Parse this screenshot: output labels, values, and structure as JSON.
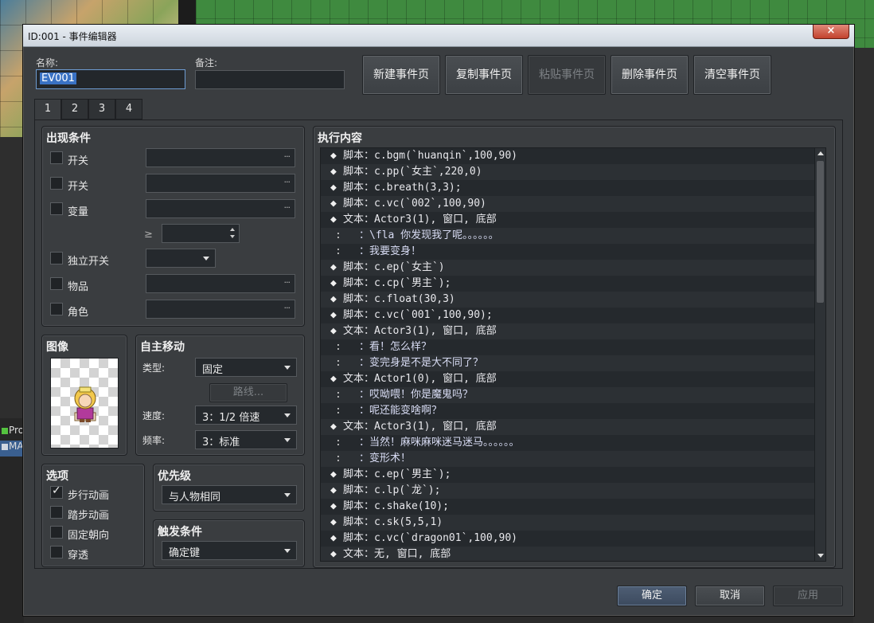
{
  "background": {
    "project_item": "Pro",
    "map_item": "MA"
  },
  "dialog": {
    "title": "ID:001 - 事件编辑器",
    "close_glyph": "×"
  },
  "header": {
    "name_label": "名称:",
    "name_value": "EV001",
    "note_label": "备注:",
    "note_value": ""
  },
  "page_buttons": {
    "new": "新建事件页",
    "copy": "复制事件页",
    "paste": "粘贴事件页",
    "delete": "删除事件页",
    "clear": "清空事件页"
  },
  "tabs": [
    "1",
    "2",
    "3",
    "4"
  ],
  "conditions": {
    "title": "出现条件",
    "switch1": "开关",
    "switch2": "开关",
    "variable": "变量",
    "ge_symbol": "≥",
    "self_switch": "独立开关",
    "item": "物品",
    "actor": "角色",
    "dots": "···"
  },
  "image": {
    "title": "图像"
  },
  "autonomous": {
    "title": "自主移动",
    "type_label": "类型:",
    "type_value": "固定",
    "route_button": "路线...",
    "speed_label": "速度:",
    "speed_value": "3：1/2 倍速",
    "freq_label": "频率:",
    "freq_value": "3：标准"
  },
  "options": {
    "title": "选项",
    "walk_anim": "步行动画",
    "step_anim": "踏步动画",
    "fixed_dir": "固定朝向",
    "through": "穿透",
    "walk_anim_checked": true
  },
  "priority": {
    "title": "优先级",
    "value": "与人物相同"
  },
  "trigger": {
    "title": "触发条件",
    "value": "确定键"
  },
  "execution": {
    "title": "执行内容",
    "rows": [
      {
        "kind": "cmd",
        "text": "脚本：c.bgm(`huanqin`,100,90)"
      },
      {
        "kind": "cmd",
        "text": "脚本：c.pp(`女主`,220,0)"
      },
      {
        "kind": "cmd",
        "text": "脚本：c.breath(3,3);"
      },
      {
        "kind": "cmd",
        "text": "脚本：c.vc(`002`,100,90)"
      },
      {
        "kind": "cmd",
        "text": "文本：Actor3(1), 窗口, 底部"
      },
      {
        "kind": "line",
        "text": "：\\fla 你发现我了呢。。。。。。"
      },
      {
        "kind": "line",
        "text": "：我要变身！"
      },
      {
        "kind": "cmd",
        "text": "脚本：c.ep(`女主`)"
      },
      {
        "kind": "cmd",
        "text": "脚本：c.cp(`男主`);"
      },
      {
        "kind": "cmd",
        "text": "脚本：c.float(30,3)"
      },
      {
        "kind": "cmd",
        "text": "脚本：c.vc(`001`,100,90);"
      },
      {
        "kind": "cmd",
        "text": "文本：Actor3(1), 窗口, 底部"
      },
      {
        "kind": "line",
        "text": "：看！怎么样？"
      },
      {
        "kind": "line",
        "text": "：变完身是不是大不同了？"
      },
      {
        "kind": "cmd",
        "text": "文本：Actor1(0), 窗口, 底部"
      },
      {
        "kind": "line",
        "text": "：哎呦喂！你是魔鬼吗？"
      },
      {
        "kind": "line",
        "text": "：呢还能变啥啊？"
      },
      {
        "kind": "cmd",
        "text": "文本：Actor3(1), 窗口, 底部"
      },
      {
        "kind": "line",
        "text": "：当然！麻咪麻咪迷马迷马。。。。。。"
      },
      {
        "kind": "line",
        "text": "：变形术！"
      },
      {
        "kind": "cmd",
        "text": "脚本：c.ep(`男主`);"
      },
      {
        "kind": "cmd",
        "text": "脚本：c.lp(`龙`);"
      },
      {
        "kind": "cmd",
        "text": "脚本：c.shake(10);"
      },
      {
        "kind": "cmd",
        "text": "脚本：c.sk(5,5,1)"
      },
      {
        "kind": "cmd",
        "text": "脚本：c.vc(`dragon01`,100,90)"
      },
      {
        "kind": "cmd",
        "text": "文本：无, 窗口, 底部"
      }
    ]
  },
  "footer": {
    "ok": "确定",
    "cancel": "取消",
    "apply": "应用"
  },
  "symbols": {
    "diamond": "◆",
    "colon": ":"
  },
  "colors": {
    "accent": "#3a72c4",
    "dialog_bg": "#3a3d40",
    "list_bg": "#25292d"
  }
}
